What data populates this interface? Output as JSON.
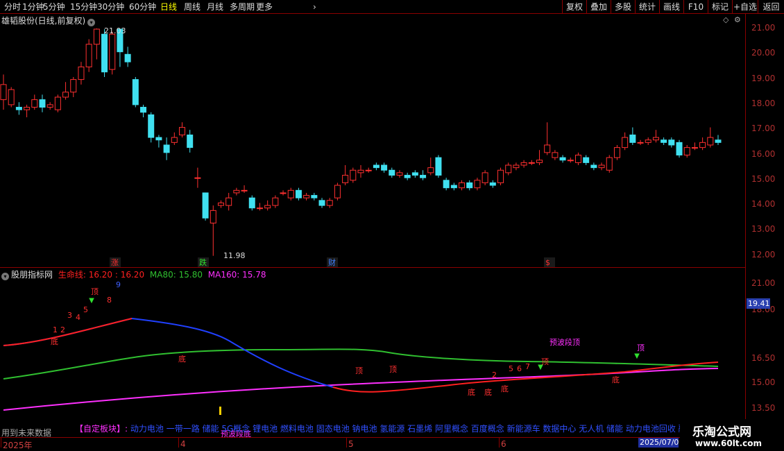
{
  "toolbar": {
    "periods": [
      "分时",
      "1分钟",
      "5分钟",
      "15分钟",
      "30分钟",
      "60分钟",
      "日线",
      "周线",
      "月线",
      "多周期",
      "更多"
    ],
    "active_period": "日线",
    "buttons": [
      "复权",
      "叠加",
      "多股",
      "统计",
      "画线",
      "F10",
      "标记",
      "+自选",
      "返回"
    ]
  },
  "price_pane": {
    "title": "雄韬股份(日线,前复权)",
    "high_label": "21.03",
    "low_label": "11.98",
    "event_markers": [
      "涨",
      "跌",
      "财",
      "$"
    ]
  },
  "price_axis": [
    "21.00",
    "20.00",
    "19.00",
    "18.00",
    "17.00",
    "16.00",
    "15.00",
    "14.00",
    "13.00",
    "12.00"
  ],
  "indicator_pane": {
    "name": "股朋指标网",
    "line1_label": "生命线: 16.20 : 16.20",
    "line2_label": "MA80: 15.80",
    "line3_label": "MA160: 15.78",
    "current_value_badge": "19.41",
    "annotations": [
      "顶",
      "底",
      "1",
      "2",
      "3",
      "4",
      "5",
      "8",
      "9",
      "5",
      "6",
      "7",
      "2",
      "3",
      "预波段顶",
      "预波段底"
    ]
  },
  "indicator_axis": [
    "21.00",
    "18.00",
    "16.50",
    "15.00",
    "13.50"
  ],
  "footer": {
    "note": "用到未来数据",
    "block_label": "【自定板块】:",
    "block_items": "动力电池 一带一路 储能 5G概念 锂电池 燃料电池 固态电池 钠电池 氢能源 石墨烯 阿里概念 百度概念 新能源车 数据中心 无人机 储能 动力电池回收 融资融券",
    "month_labels": [
      "2025年",
      "4",
      "5",
      "6"
    ],
    "current_date": "2025/07/0"
  },
  "watermark": {
    "title": "乐淘公式网",
    "url": "www.60lt.com"
  },
  "chart_data": {
    "type": "candlestick",
    "title": "雄韬股份(日线,前复权)",
    "ylim": [
      11.7,
      21.6
    ],
    "candles": [
      [
        18.2,
        18.8,
        17.8,
        19.2
      ],
      [
        18.0,
        18.6,
        17.9,
        18.7
      ],
      [
        17.9,
        17.8,
        17.6,
        18.1
      ],
      [
        17.8,
        17.9,
        17.5,
        18.0
      ],
      [
        17.9,
        18.2,
        17.8,
        18.4
      ],
      [
        18.2,
        17.9,
        17.7,
        18.4
      ],
      [
        17.9,
        18.0,
        17.8,
        18.1
      ],
      [
        17.8,
        18.3,
        17.7,
        18.4
      ],
      [
        18.3,
        18.5,
        18.2,
        18.9
      ],
      [
        18.5,
        19.0,
        18.3,
        19.1
      ],
      [
        19.0,
        19.5,
        18.8,
        19.7
      ],
      [
        19.5,
        20.4,
        19.3,
        20.6
      ],
      [
        20.4,
        21.0,
        19.8,
        21.03
      ],
      [
        20.8,
        19.3,
        19.1,
        21.0
      ],
      [
        19.4,
        20.8,
        19.2,
        20.9
      ],
      [
        21.0,
        20.1,
        19.5,
        21.0
      ],
      [
        20.0,
        19.7,
        19.5,
        20.3
      ],
      [
        19.0,
        18.0,
        17.9,
        19.1
      ],
      [
        17.9,
        17.7,
        17.5,
        18.0
      ],
      [
        17.6,
        16.7,
        16.5,
        17.7
      ],
      [
        16.7,
        16.6,
        16.3,
        16.8
      ],
      [
        16.4,
        16.1,
        15.8,
        16.7
      ],
      [
        16.5,
        16.7,
        16.4,
        16.9
      ],
      [
        16.8,
        17.1,
        16.7,
        17.3
      ],
      [
        16.8,
        16.3,
        16.1,
        17.0
      ],
      [
        15.1,
        15.1,
        14.7,
        15.5
      ],
      [
        14.5,
        13.5,
        13.4,
        14.5
      ],
      [
        13.3,
        13.8,
        12.0,
        14.0
      ],
      [
        14.0,
        14.1,
        13.9,
        14.2
      ],
      [
        14.0,
        14.3,
        13.8,
        14.5
      ],
      [
        14.5,
        14.6,
        14.4,
        14.7
      ],
      [
        14.6,
        14.6,
        14.5,
        14.8
      ],
      [
        14.3,
        13.9,
        13.8,
        14.4
      ],
      [
        13.9,
        13.9,
        13.8,
        14.1
      ],
      [
        13.9,
        14.0,
        13.8,
        14.2
      ],
      [
        14.0,
        14.3,
        13.9,
        14.4
      ],
      [
        14.5,
        14.5,
        14.4,
        14.6
      ],
      [
        14.3,
        14.6,
        14.2,
        14.7
      ],
      [
        14.6,
        14.3,
        14.2,
        14.7
      ],
      [
        14.3,
        14.4,
        14.2,
        14.5
      ],
      [
        14.4,
        14.3,
        14.2,
        14.5
      ],
      [
        14.2,
        14.0,
        13.9,
        14.3
      ],
      [
        14.0,
        14.2,
        13.9,
        14.3
      ],
      [
        14.3,
        14.8,
        14.2,
        14.9
      ],
      [
        14.9,
        15.2,
        14.8,
        15.6
      ],
      [
        15.0,
        15.4,
        14.9,
        15.5
      ],
      [
        15.3,
        15.4,
        15.1,
        15.6
      ],
      [
        15.4,
        15.4,
        15.3,
        15.5
      ],
      [
        15.6,
        15.5,
        15.4,
        15.7
      ],
      [
        15.6,
        15.4,
        15.3,
        15.7
      ],
      [
        15.4,
        15.2,
        15.1,
        15.5
      ],
      [
        15.2,
        15.3,
        15.1,
        15.4
      ],
      [
        15.2,
        15.1,
        15.0,
        15.3
      ],
      [
        15.3,
        15.2,
        15.1,
        15.4
      ],
      [
        15.2,
        15.1,
        15.0,
        15.4
      ],
      [
        15.3,
        15.5,
        15.2,
        15.9
      ],
      [
        15.9,
        15.2,
        15.1,
        16.0
      ],
      [
        15.0,
        14.7,
        14.6,
        15.1
      ],
      [
        14.8,
        14.7,
        14.6,
        14.9
      ],
      [
        14.7,
        14.9,
        14.6,
        15.0
      ],
      [
        14.9,
        14.7,
        14.6,
        15.0
      ],
      [
        14.7,
        15.0,
        14.6,
        15.1
      ],
      [
        14.9,
        15.3,
        14.8,
        15.4
      ],
      [
        14.9,
        14.8,
        14.7,
        15.0
      ],
      [
        14.9,
        15.4,
        14.8,
        15.5
      ],
      [
        15.3,
        15.6,
        15.2,
        15.7
      ],
      [
        15.5,
        15.6,
        15.4,
        15.7
      ],
      [
        15.6,
        15.7,
        15.5,
        15.8
      ],
      [
        15.7,
        15.7,
        15.6,
        15.8
      ],
      [
        15.7,
        15.8,
        15.6,
        16.2
      ],
      [
        16.1,
        16.4,
        16.0,
        17.3
      ],
      [
        15.9,
        16.1,
        15.8,
        16.2
      ],
      [
        15.9,
        15.8,
        15.7,
        16.0
      ],
      [
        15.8,
        15.8,
        15.7,
        15.9
      ],
      [
        15.7,
        16.0,
        15.6,
        16.1
      ],
      [
        15.9,
        15.7,
        15.6,
        16.0
      ],
      [
        15.6,
        15.5,
        15.4,
        15.7
      ],
      [
        15.5,
        15.6,
        15.4,
        15.7
      ],
      [
        15.4,
        15.9,
        15.3,
        16.0
      ],
      [
        15.9,
        16.3,
        15.8,
        16.4
      ],
      [
        16.3,
        16.7,
        16.2,
        16.9
      ],
      [
        16.8,
        16.5,
        16.4,
        17.1
      ],
      [
        16.5,
        16.5,
        16.4,
        16.6
      ],
      [
        16.5,
        16.6,
        16.4,
        16.7
      ],
      [
        16.6,
        16.7,
        16.5,
        17.0
      ],
      [
        16.6,
        16.5,
        16.4,
        16.7
      ],
      [
        16.6,
        16.4,
        16.3,
        16.7
      ],
      [
        16.5,
        16.0,
        15.9,
        16.6
      ],
      [
        16.0,
        16.3,
        15.9,
        16.4
      ],
      [
        16.3,
        16.3,
        16.2,
        16.5
      ],
      [
        16.3,
        16.5,
        16.2,
        16.7
      ],
      [
        16.4,
        16.7,
        16.3,
        17.1
      ],
      [
        16.6,
        16.5,
        16.4,
        16.8
      ]
    ]
  }
}
